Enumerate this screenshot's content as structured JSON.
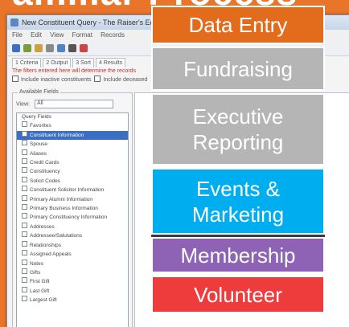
{
  "headline": "Familiar Process",
  "app": {
    "title": "New Constituent Query - The Raiser's Edge",
    "menu": [
      "File",
      "Edit",
      "View",
      "Format",
      "Records"
    ],
    "tabs": [
      "1 Criteria",
      "2 Output",
      "3 Sort",
      "4 Results"
    ],
    "info": "The filters entered here will determine the records",
    "checks": [
      "Include inactive constituents",
      "Include deceased"
    ],
    "available_fields_label": "Available Fields",
    "view_label": "View:",
    "view_value": "All",
    "tree_items": [
      {
        "text": "Query Fields",
        "highlight": false
      },
      {
        "text": "Favorites",
        "highlight": false
      },
      {
        "text": "Constituent Information",
        "highlight": true
      },
      {
        "text": "Spouse",
        "highlight": false
      },
      {
        "text": "Aliases",
        "highlight": false
      },
      {
        "text": "Credit Cards",
        "highlight": false
      },
      {
        "text": "Constituency",
        "highlight": false
      },
      {
        "text": "Solicit Codes",
        "highlight": false
      },
      {
        "text": "Constituent Solicitor Information",
        "highlight": false
      },
      {
        "text": "Primary Alumni Information",
        "highlight": false
      },
      {
        "text": "Primary Business Information",
        "highlight": false
      },
      {
        "text": "Primary Constituency Information",
        "highlight": false
      },
      {
        "text": "Addresses",
        "highlight": false
      },
      {
        "text": "Addressee/Salutations",
        "highlight": false
      },
      {
        "text": "Relationships",
        "highlight": false
      },
      {
        "text": "Assigned Appeals",
        "highlight": false
      },
      {
        "text": "Notes",
        "highlight": false
      },
      {
        "text": "Gifts",
        "highlight": false
      },
      {
        "text": "First Gift",
        "highlight": false
      },
      {
        "text": "Last Gift",
        "highlight": false
      },
      {
        "text": "Largest Gift",
        "highlight": false
      }
    ]
  },
  "labels": [
    {
      "lines": [
        "Data Entry"
      ],
      "color": "#e36c1c"
    },
    {
      "lines": [
        "Fundraising"
      ],
      "color": "#b5b5b5"
    },
    {
      "lines": [
        "Executive",
        "Reporting"
      ],
      "color": "#b5b5b5"
    },
    {
      "lines": [
        "Events &",
        "Marketing"
      ],
      "color": "#00aeef"
    },
    {
      "lines": [
        "Membership"
      ],
      "color": "#8e63b5"
    },
    {
      "lines": [
        "Volunteer"
      ],
      "color": "#ee3b3b"
    }
  ]
}
